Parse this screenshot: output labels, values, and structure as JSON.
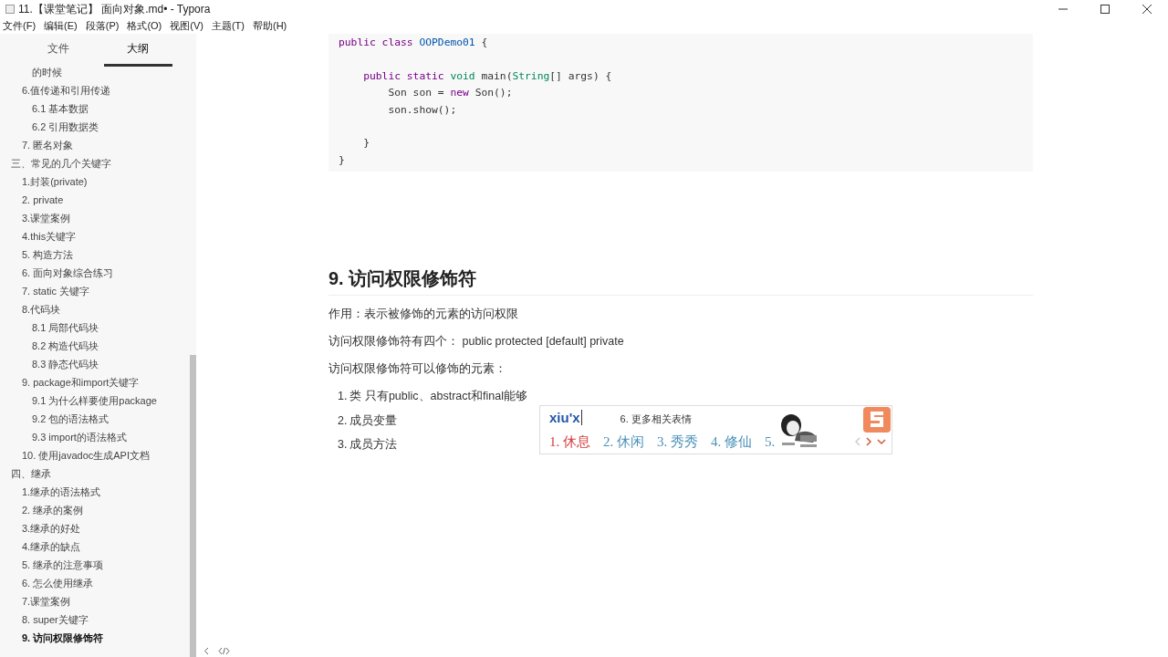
{
  "window": {
    "title": "11.【课堂笔记】 面向对象.md• - Typora"
  },
  "menu": [
    "文件(F)",
    "编辑(E)",
    "段落(P)",
    "格式(O)",
    "视图(V)",
    "主题(T)",
    "帮助(H)"
  ],
  "sidebar": {
    "tabs": [
      {
        "label": "文件",
        "selected": false
      },
      {
        "label": "大纲",
        "selected": true
      }
    ],
    "outline": [
      {
        "children": [
          {
            "children": [
              {
                "text": "的时候",
                "selected": false
              }
            ]
          },
          {
            "text": "6.值传递和引用传递",
            "selected": false,
            "children": [
              {
                "text": "6.1 基本数据",
                "selected": false
              },
              {
                "text": "6.2 引用数据类",
                "selected": false
              }
            ]
          },
          {
            "text": "7. 匿名对象",
            "selected": false
          }
        ]
      },
      {
        "text": "三、常见的几个关键字",
        "selected": false,
        "children": [
          {
            "text": "1.封装(private)",
            "selected": false
          },
          {
            "text": "2. private",
            "selected": false
          },
          {
            "text": "3.课堂案例",
            "selected": false
          },
          {
            "text": "4.this关键字",
            "selected": false
          },
          {
            "text": "5. 构造方法",
            "selected": false
          },
          {
            "text": "6. 面向对象综合练习",
            "selected": false
          },
          {
            "text": "7. static 关键字",
            "selected": false
          },
          {
            "text": "8.代码块",
            "selected": false,
            "children": [
              {
                "text": "8.1 局部代码块",
                "selected": false
              },
              {
                "text": "8.2 构造代码块",
                "selected": false
              },
              {
                "text": "8.3 静态代码块",
                "selected": false
              }
            ]
          },
          {
            "text": "9. package和import关键字",
            "selected": false,
            "children": [
              {
                "text": "9.1 为什么样要使用package",
                "selected": false
              },
              {
                "text": "9.2 包的语法格式",
                "selected": false
              },
              {
                "text": "9.3 import的语法格式",
                "selected": false
              }
            ]
          },
          {
            "text": "10. 使用javadoc生成API文档",
            "selected": false
          }
        ]
      },
      {
        "text": "四、继承",
        "selected": false,
        "children": [
          {
            "text": "1.继承的语法格式",
            "selected": false
          },
          {
            "text": "2. 继承的案例",
            "selected": false
          },
          {
            "text": "3.继承的好处",
            "selected": false
          },
          {
            "text": "4.继承的缺点",
            "selected": false
          },
          {
            "text": "5. 继承的注意事项",
            "selected": false
          },
          {
            "text": "6. 怎么使用继承",
            "selected": false
          },
          {
            "text": "7.课堂案例",
            "selected": false
          },
          {
            "text": "8. super关键字",
            "selected": false
          },
          {
            "text": "9. 访问权限修饰符",
            "selected": true
          }
        ]
      }
    ]
  },
  "code_block": {
    "lines": [
      {
        "tokens": [
          {
            "text": "public",
            "kind": "keyword"
          },
          {
            "text": " class ",
            "kind": "keyword"
          },
          {
            "text": "OOPDemo01",
            "kind": "name"
          },
          {
            "text": " {",
            "kind": "plain"
          }
        ]
      },
      {
        "kind": "blank"
      },
      {
        "tokens": [
          {
            "text": "    public static ",
            "kind": "keyword"
          },
          {
            "text": "void",
            "kind": "type"
          },
          {
            "text": " main(",
            "kind": "plain"
          },
          {
            "text": "String",
            "kind": "type"
          },
          {
            "text": "[] args) {",
            "kind": "plain"
          }
        ]
      },
      {
        "tokens": [
          {
            "text": "        Son son = ",
            "kind": "plain"
          },
          {
            "text": "new",
            "kind": "keyword"
          },
          {
            "text": " Son();",
            "kind": "plain"
          }
        ]
      },
      {
        "tokens": [
          {
            "text": "        son.show();",
            "kind": "plain"
          }
        ]
      },
      {
        "kind": "blank"
      },
      {
        "tokens": [
          {
            "text": "    }",
            "kind": "plain"
          }
        ]
      },
      {
        "tokens": [
          {
            "text": "}",
            "kind": "plain"
          }
        ]
      }
    ]
  },
  "heading": "9. 访问权限修饰符",
  "paragraphs": [
    "作用：表示被修饰的元素的访问权限",
    "访问权限修饰符有四个： public protected [default] private",
    "访问权限修饰符可以修饰的元素："
  ],
  "list": [
    {
      "number": "1.",
      "text": "类  只有public、abstract和final能够"
    },
    {
      "number": "2.",
      "text": "成员变量"
    },
    {
      "number": "3.",
      "text": "成员方法"
    }
  ],
  "ime": {
    "input": "xiu'x",
    "hint": "6. 更多相关表情",
    "candidates": [
      {
        "text": "1. 休息",
        "selected": true
      },
      {
        "text": "2. 休闲",
        "selected": false
      },
      {
        "text": "3. 秀秀",
        "selected": false
      },
      {
        "text": "4. 修仙",
        "selected": false
      },
      {
        "text": "5.",
        "selected": false,
        "kind": "picture"
      }
    ]
  }
}
